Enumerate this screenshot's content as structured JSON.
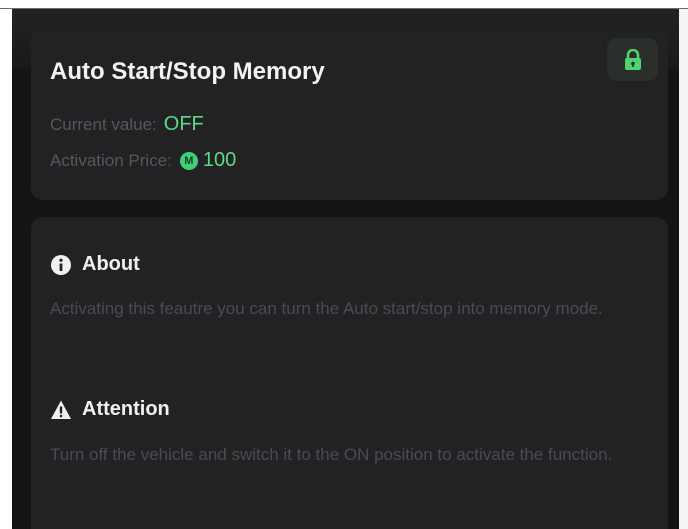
{
  "feature": {
    "title": "Auto Start/Stop Memory",
    "current_value_label": "Current value:",
    "current_value": "OFF",
    "price_label": "Activation Price:",
    "coin_glyph": "M",
    "price_value": "100",
    "lock_icon": "lock-icon"
  },
  "about": {
    "heading": "About",
    "icon": "info-icon",
    "text": "Activating this feautre you can turn the Auto start/stop into memory mode."
  },
  "attention": {
    "heading": "Attention",
    "icon": "warning-icon",
    "text": "Turn off the vehicle and switch it to the ON position to activate the function."
  },
  "colors": {
    "accent_green": "#5fd882",
    "card_bg": "#222225",
    "screen_bg": "#141416"
  }
}
